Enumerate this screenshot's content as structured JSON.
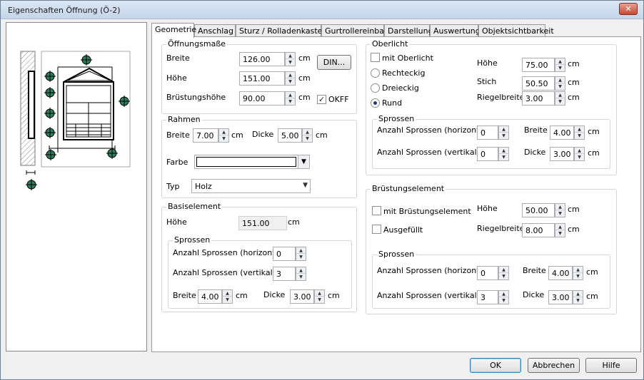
{
  "window": {
    "title": "Eigenschaften Öffnung (Ö-2)",
    "close_label": "✕"
  },
  "tabs": [
    "Geometrie",
    "Anschlag",
    "Sturz / Rolladenkasten",
    "Gurtrollereinbau",
    "Darstellung",
    "Auswertung",
    "Objektsichtbarkeit"
  ],
  "unit": "cm",
  "oeffnungsmasse": {
    "title": "Öffnungsmaße",
    "breite_label": "Breite",
    "breite": "126.00",
    "hoehe_label": "Höhe",
    "hoehe": "151.00",
    "bruestungshoehe_label": "Brüstungshöhe",
    "bruestungshoehe": "90.00",
    "din_button": "DIN...",
    "okff_label": "OKFF",
    "okff_checked": "✓"
  },
  "rahmen": {
    "title": "Rahmen",
    "breite_label": "Breite",
    "breite": "7.00",
    "dicke_label": "Dicke",
    "dicke": "5.00",
    "farbe_label": "Farbe",
    "farbe_color": "#ffffff",
    "typ_label": "Typ",
    "typ": "Holz"
  },
  "basiselement": {
    "title": "Basiselement",
    "hoehe_label": "Höhe",
    "hoehe": "151.00",
    "sprossen_title": "Sprossen",
    "anzahl_h_label": "Anzahl Sprossen (horizontal)",
    "anzahl_h": "0",
    "anzahl_v_label": "Anzahl Sprossen (vertikal)",
    "anzahl_v": "3",
    "breite_label": "Breite",
    "breite": "4.00",
    "dicke_label": "Dicke",
    "dicke": "3.00"
  },
  "oberlicht": {
    "title": "Oberlicht",
    "mit_label": "mit Oberlicht",
    "rechteckig_label": "Rechteckig",
    "dreieckig_label": "Dreieckig",
    "rund_label": "Rund",
    "hoehe_label": "Höhe",
    "hoehe": "75.00",
    "stich_label": "Stich",
    "stich": "50.50",
    "riegelbreite_label": "Riegelbreite",
    "riegelbreite": "3.00",
    "sprossen_title": "Sprossen",
    "anzahl_h_label": "Anzahl Sprossen (horizontal)",
    "anzahl_h": "0",
    "anzahl_v_label": "Anzahl Sprossen (vertikal)",
    "anzahl_v": "0",
    "breite_label": "Breite",
    "breite": "4.00",
    "dicke_label": "Dicke",
    "dicke": "3.00"
  },
  "bruestungselement": {
    "title": "Brüstungselement",
    "mit_label": "mit Brüstungselement",
    "ausgefuellt_label": "Ausgefüllt",
    "hoehe_label": "Höhe",
    "hoehe": "50.00",
    "riegelbreite_label": "Riegelbreite",
    "riegelbreite": "8.00",
    "sprossen_title": "Sprossen",
    "anzahl_h_label": "Anzahl Sprossen (horizontal)",
    "anzahl_h": "0",
    "anzahl_v_label": "Anzahl Sprossen (vertikal)",
    "anzahl_v": "3",
    "breite_label": "Breite",
    "breite": "4.00",
    "dicke_label": "Dicke",
    "dicke": "3.00"
  },
  "buttons": {
    "ok": "OK",
    "abbrechen": "Abbrechen",
    "hilfe": "Hilfe"
  },
  "colors": {
    "handle": "#2e7d5b",
    "tab_border": "#9a9a9a",
    "default_button": "#3c7fb1"
  }
}
